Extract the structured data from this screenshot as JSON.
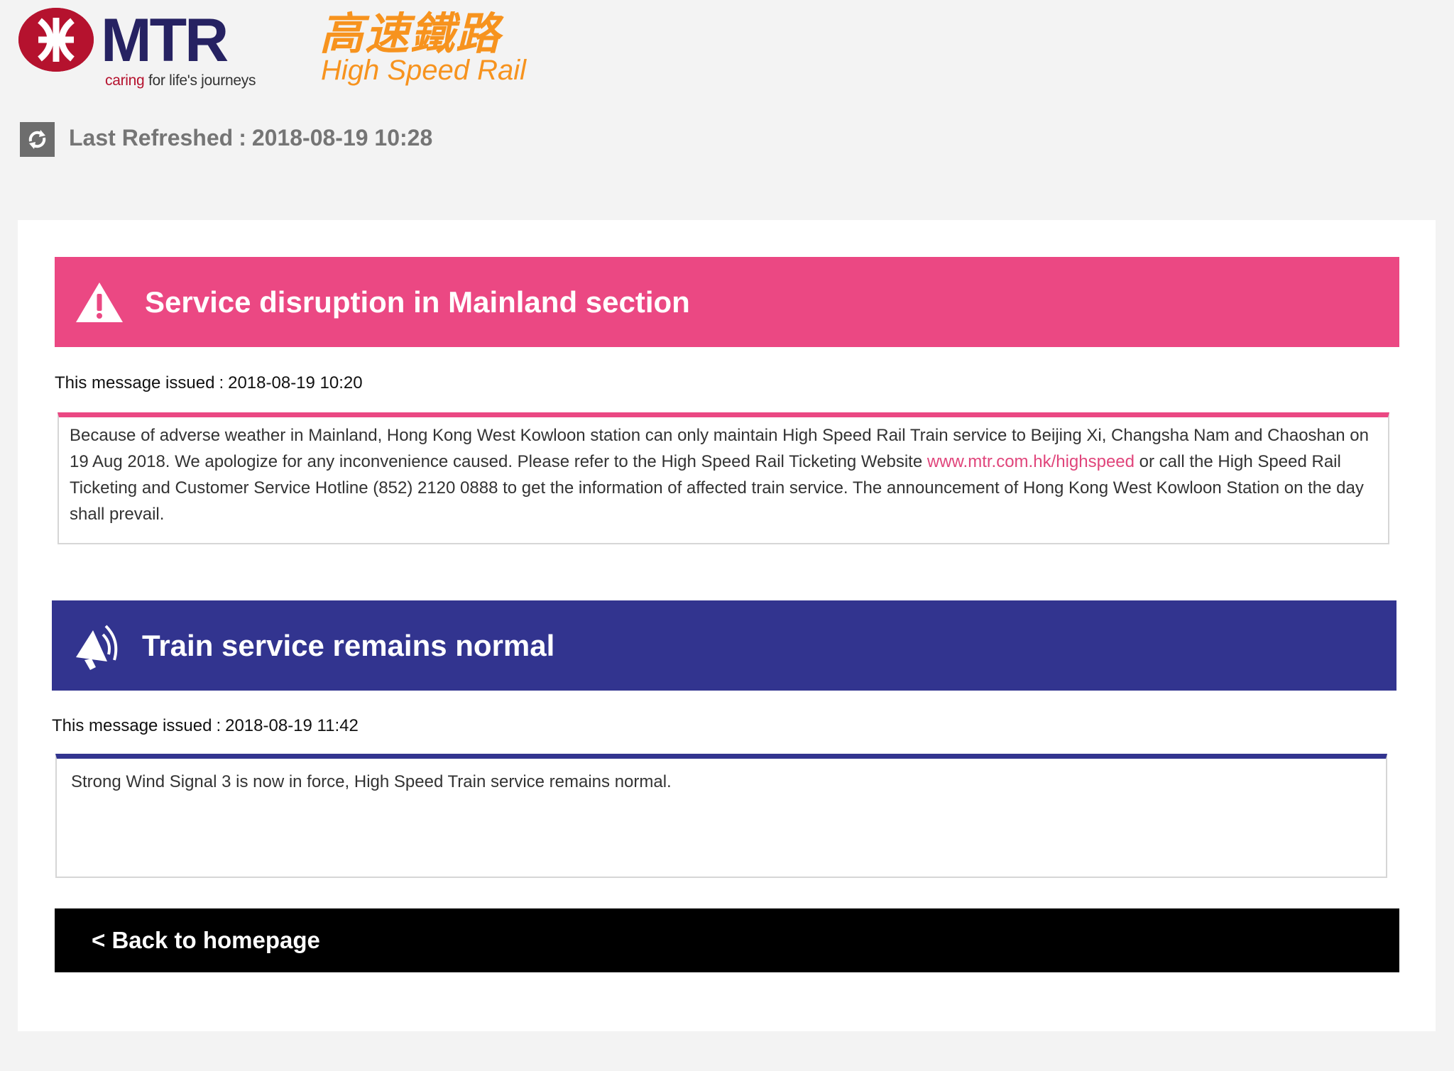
{
  "header": {
    "mtr_logo_word": "MTR",
    "mtr_tagline_caring": "caring",
    "mtr_tagline_rest": "for life's journeys",
    "hsr_logo_zh": "高速鐵路",
    "hsr_logo_en": "High Speed Rail",
    "refresh_icon": "refresh-icon",
    "last_refreshed_label": "Last Refreshed",
    "last_refreshed_sep": ":",
    "last_refreshed_value": "2018-08-19 10:28"
  },
  "alerts": [
    {
      "icon": "warning-icon",
      "title": "Service disruption in Mainland section",
      "issued_label": "This message issued",
      "issued_sep": ":",
      "issued_value": "2018-08-19 10:20",
      "body_part1": "Because of adverse weather in Mainland, Hong Kong West Kowloon station can only maintain High Speed Rail Train service to Beijing Xi, Changsha Nam and Chaoshan on 19 Aug 2018. We apologize for any inconvenience caused. Please refer to the High Speed Rail Ticketing Website ",
      "body_link": "www.mtr.com.hk/highspeed",
      "body_part2": " or call the High Speed Rail Ticketing and Customer Service Hotline (852) 2120 0888 to get the information of affected train service. The announcement of Hong Kong West Kowloon Station on the day shall prevail.",
      "color": "#eb4883"
    },
    {
      "icon": "megaphone-icon",
      "title": "Train service remains normal",
      "issued_label": "This message issued",
      "issued_sep": ":",
      "issued_value": "2018-08-19 11:42",
      "body": "Strong Wind Signal 3 is now in force, High Speed Train service remains normal.",
      "color": "#32348f"
    }
  ],
  "footer": {
    "back_label": "< Back to homepage"
  },
  "colors": {
    "mtr_red": "#b5122e",
    "mtr_navy": "#262262",
    "hsr_orange": "#f7931e",
    "background": "#f3f3f3"
  }
}
